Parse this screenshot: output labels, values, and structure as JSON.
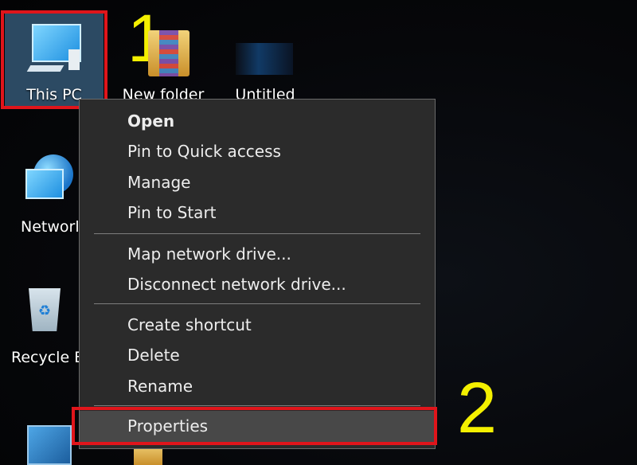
{
  "desktop": {
    "icons": [
      {
        "label": "This PC"
      },
      {
        "label": "New folder"
      },
      {
        "label": "Untitled"
      },
      {
        "label": "Networl"
      },
      {
        "label": "Recycle B"
      }
    ],
    "step_labels": [
      "1",
      "2"
    ],
    "highlight_color": "#e0151b",
    "step_color": "#f4f000"
  },
  "context_menu": {
    "group1": [
      "Open",
      "Pin to Quick access",
      "Manage",
      "Pin to Start"
    ],
    "group2": [
      "Map network drive...",
      "Disconnect network drive..."
    ],
    "group3": [
      "Create shortcut",
      "Delete",
      "Rename"
    ],
    "group4": [
      "Properties"
    ]
  }
}
